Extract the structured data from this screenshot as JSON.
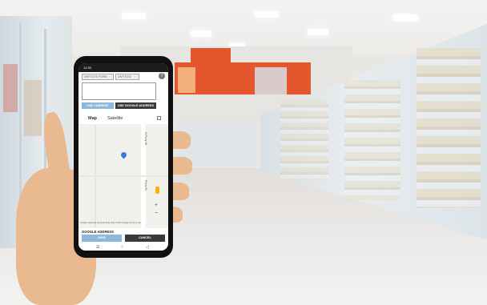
{
  "phone": {
    "status_time": "12:30",
    "top_fields": [
      "UNTITLED FORM",
      "UNTITLED"
    ],
    "help_label": "?",
    "use_current_label": "USE CURRENT",
    "use_google_address_label": "USE GOOGLE ADDRESS",
    "map_tab_label": "Map",
    "satellite_tab_label": "Satellite",
    "street_label_1": "N Ferry St",
    "street_label_2": "Ferry St",
    "map_attribution": "Google   Keyboard shortcuts   Map data ©2023 Google   Terms of Use",
    "zoom_in": "+",
    "zoom_out": "−",
    "google_address_label": "GOOGLE ADDRESS",
    "save_label": "SAVE",
    "cancel_label": "CANCEL",
    "nav": [
      "☰",
      "○",
      "◁"
    ]
  },
  "colors": {
    "accent_blue": "#8fb7dc",
    "dark_button": "#3a3a3a",
    "pin_blue": "#3b7be0",
    "store_red": "#e4572e"
  },
  "icons": {
    "help": "help-icon",
    "fullscreen": "fullscreen-icon",
    "pin": "location-pin-icon",
    "pegman": "street-view-pegman-icon"
  }
}
